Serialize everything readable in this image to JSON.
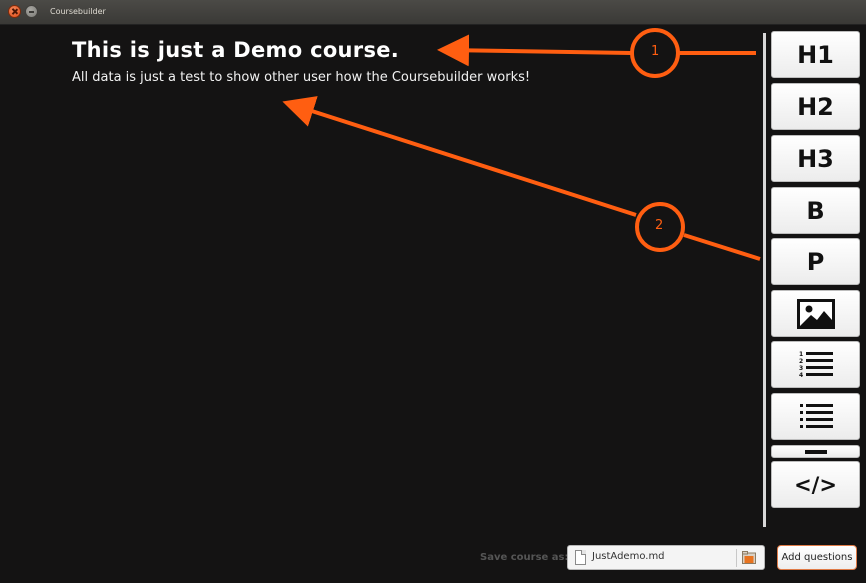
{
  "window": {
    "title": "Coursebuilder"
  },
  "document": {
    "heading": "This is just a Demo course.",
    "paragraph": "All data is just a test to show other user how the Coursebuilder works!"
  },
  "toolbar": {
    "h1": "H1",
    "h2": "H2",
    "h3": "H3",
    "bold": "B",
    "paragraph": "P",
    "code": "</>",
    "icons": [
      "image-icon",
      "numbered-list-icon",
      "bullet-list-icon",
      "horizontal-rule-icon"
    ]
  },
  "footer": {
    "save_label": "Save course as:",
    "file_name": "JustAdemo.md",
    "add_questions": "Add questions"
  },
  "annotations": {
    "badge1": "1",
    "badge2": "2",
    "color": "#ff5e11"
  }
}
